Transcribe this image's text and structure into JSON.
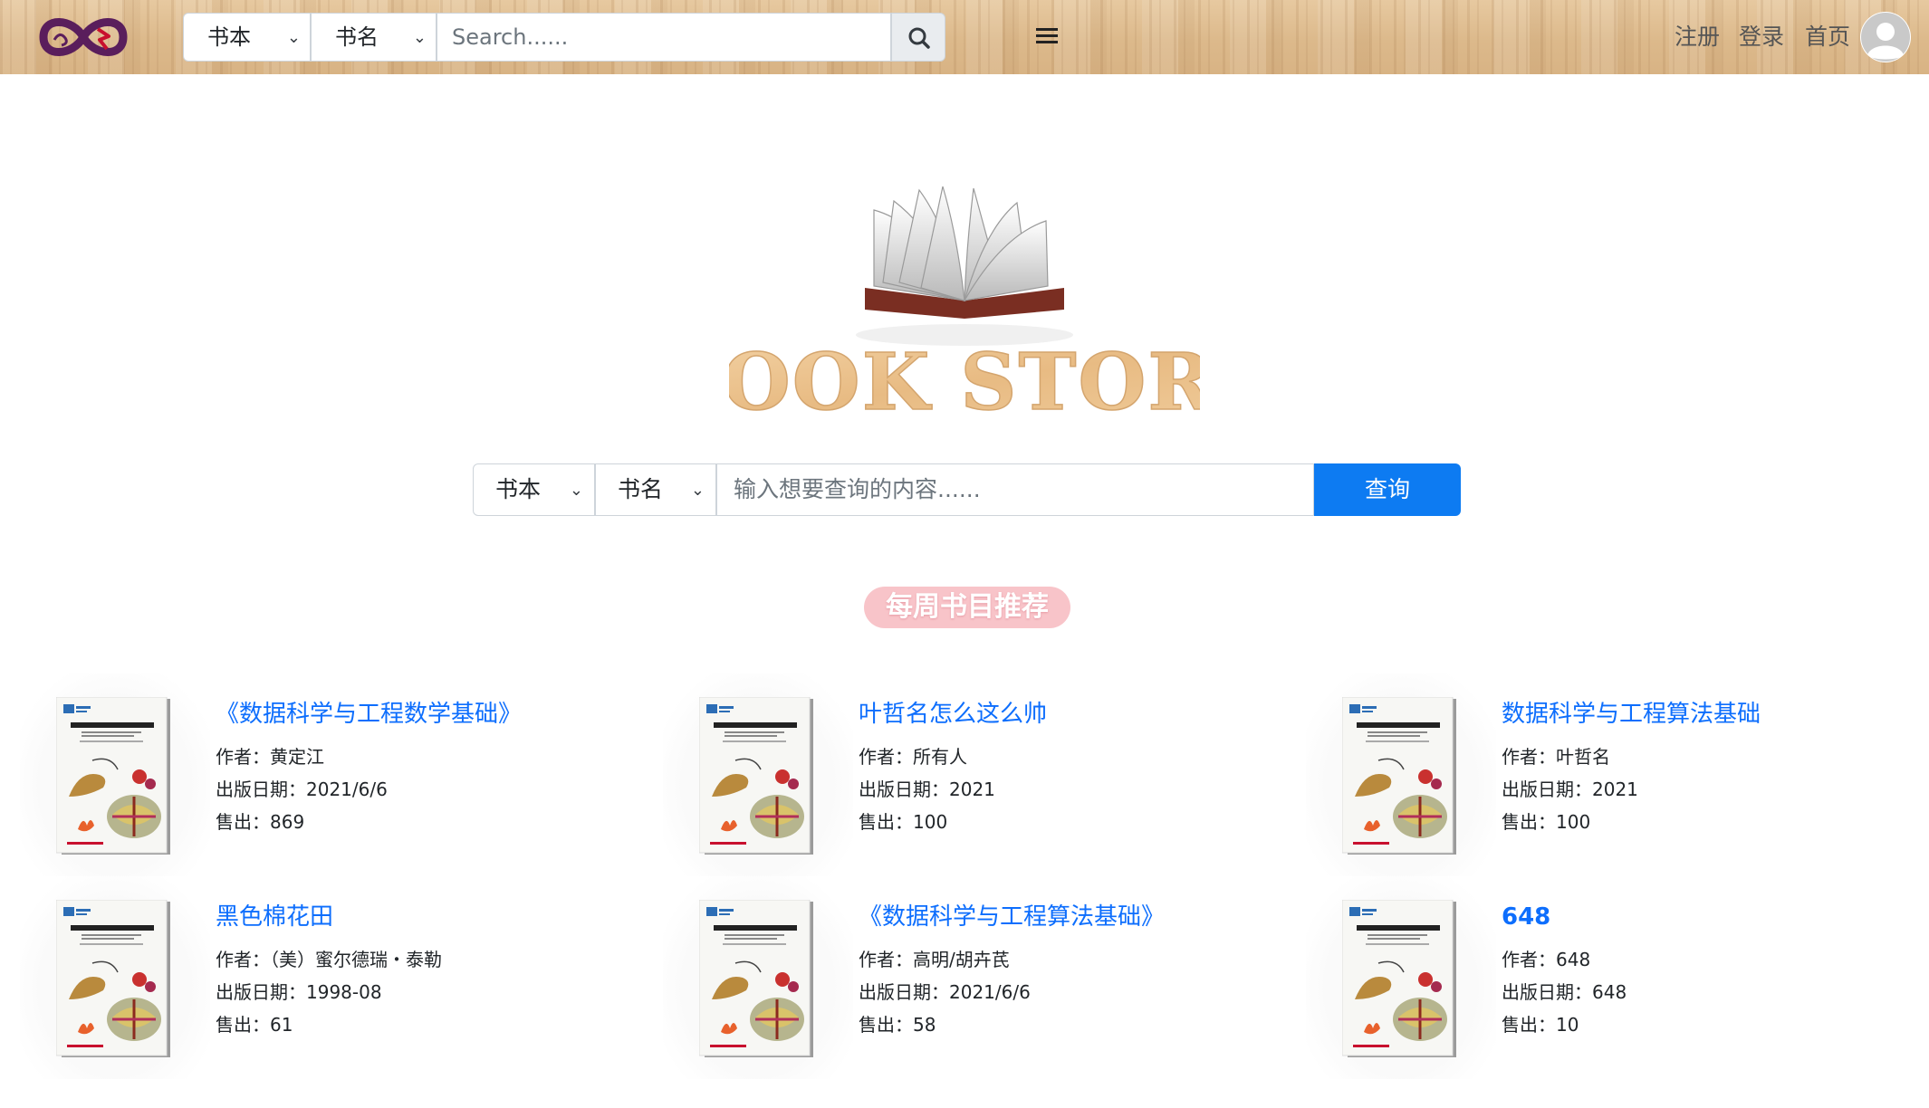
{
  "navbar": {
    "type_select": "书本",
    "field_select": "书名",
    "search_placeholder": "Search......",
    "links": {
      "register": "注册",
      "login": "登录",
      "home": "首页"
    }
  },
  "hero": {
    "logo_text": "BOOK STORE"
  },
  "search": {
    "type_select": "书本",
    "field_select": "书名",
    "placeholder": "输入想要查询的内容......",
    "submit_label": "查询"
  },
  "section": {
    "title": "每周书目推荐"
  },
  "labels": {
    "author": "作者：",
    "date": "出版日期：",
    "sold": "售出："
  },
  "books": [
    {
      "title": "《数据科学与工程数学基础》",
      "author": "黄定江",
      "date": "2021/6/6",
      "sold": "869"
    },
    {
      "title": "叶哲名怎么这么帅",
      "author": "所有人",
      "date": "2021",
      "sold": "100"
    },
    {
      "title": "数据科学与工程算法基础",
      "author": "叶哲名",
      "date": "2021",
      "sold": "100"
    },
    {
      "title": "黑色棉花田",
      "author": "（美）蜜尔德瑞・泰勒",
      "date": "1998-08",
      "sold": "61"
    },
    {
      "title": "《数据科学与工程算法基础》",
      "author": "高明/胡卉芪",
      "date": "2021/6/6",
      "sold": "58"
    },
    {
      "title": "648",
      "author": "648",
      "date": "648",
      "sold": "10"
    }
  ],
  "colors": {
    "accent": "#0d7bf2",
    "link": "#0d6efd",
    "badge": "#f8c4c9",
    "navbar_wood": "#dcb98b",
    "logo_purple": "#5a1e5c",
    "logo_red": "#c8102e"
  }
}
